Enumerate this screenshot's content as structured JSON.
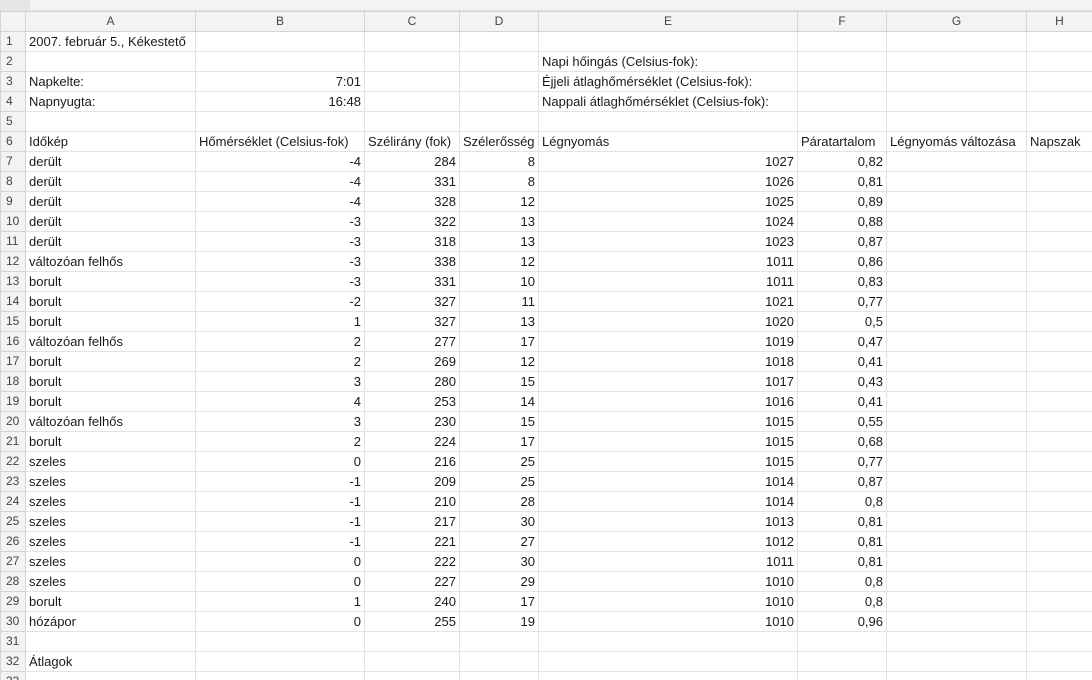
{
  "columns": [
    "A",
    "B",
    "C",
    "D",
    "E",
    "F",
    "G",
    "H"
  ],
  "cells": {
    "r1": {
      "a": "2007. február 5., Kékestető"
    },
    "r2": {
      "e": "Napi hőingás (Celsius-fok):"
    },
    "r3": {
      "a": "Napkelte:",
      "b": "7:01",
      "e": "Éjjeli átlaghőmérséklet (Celsius-fok):"
    },
    "r4": {
      "a": "Napnyugta:",
      "b": "16:48",
      "e": "Nappali átlaghőmérséklet (Celsius-fok):"
    },
    "r6": {
      "a": "Időkép",
      "b": "Hőmérséklet (Celsius-fok)",
      "c": "Szélirány (fok)",
      "d": "Szélerősség",
      "e": "Légnyomás",
      "f": "Páratartalom",
      "g": "Légnyomás változása",
      "h": "Napszak"
    },
    "r7": {
      "a": "derült",
      "b": "-4",
      "c": "284",
      "d": "8",
      "e": "1027",
      "f": "0,82"
    },
    "r8": {
      "a": "derült",
      "b": "-4",
      "c": "331",
      "d": "8",
      "e": "1026",
      "f": "0,81"
    },
    "r9": {
      "a": "derült",
      "b": "-4",
      "c": "328",
      "d": "12",
      "e": "1025",
      "f": "0,89"
    },
    "r10": {
      "a": "derült",
      "b": "-3",
      "c": "322",
      "d": "13",
      "e": "1024",
      "f": "0,88"
    },
    "r11": {
      "a": "derült",
      "b": "-3",
      "c": "318",
      "d": "13",
      "e": "1023",
      "f": "0,87"
    },
    "r12": {
      "a": "változóan felhős",
      "b": "-3",
      "c": "338",
      "d": "12",
      "e": "1011",
      "f": "0,86"
    },
    "r13": {
      "a": "borult",
      "b": "-3",
      "c": "331",
      "d": "10",
      "e": "1011",
      "f": "0,83"
    },
    "r14": {
      "a": "borult",
      "b": "-2",
      "c": "327",
      "d": "11",
      "e": "1021",
      "f": "0,77"
    },
    "r15": {
      "a": "borult",
      "b": "1",
      "c": "327",
      "d": "13",
      "e": "1020",
      "f": "0,5"
    },
    "r16": {
      "a": "változóan felhős",
      "b": "2",
      "c": "277",
      "d": "17",
      "e": "1019",
      "f": "0,47"
    },
    "r17": {
      "a": "borult",
      "b": "2",
      "c": "269",
      "d": "12",
      "e": "1018",
      "f": "0,41"
    },
    "r18": {
      "a": "borult",
      "b": "3",
      "c": "280",
      "d": "15",
      "e": "1017",
      "f": "0,43"
    },
    "r19": {
      "a": "borult",
      "b": "4",
      "c": "253",
      "d": "14",
      "e": "1016",
      "f": "0,41"
    },
    "r20": {
      "a": "változóan felhős",
      "b": "3",
      "c": "230",
      "d": "15",
      "e": "1015",
      "f": "0,55"
    },
    "r21": {
      "a": "borult",
      "b": "2",
      "c": "224",
      "d": "17",
      "e": "1015",
      "f": "0,68"
    },
    "r22": {
      "a": "szeles",
      "b": "0",
      "c": "216",
      "d": "25",
      "e": "1015",
      "f": "0,77"
    },
    "r23": {
      "a": "szeles",
      "b": "-1",
      "c": "209",
      "d": "25",
      "e": "1014",
      "f": "0,87"
    },
    "r24": {
      "a": "szeles",
      "b": "-1",
      "c": "210",
      "d": "28",
      "e": "1014",
      "f": "0,8"
    },
    "r25": {
      "a": "szeles",
      "b": "-1",
      "c": "217",
      "d": "30",
      "e": "1013",
      "f": "0,81"
    },
    "r26": {
      "a": "szeles",
      "b": "-1",
      "c": "221",
      "d": "27",
      "e": "1012",
      "f": "0,81"
    },
    "r27": {
      "a": "szeles",
      "b": "0",
      "c": "222",
      "d": "30",
      "e": "1011",
      "f": "0,81"
    },
    "r28": {
      "a": "szeles",
      "b": "0",
      "c": "227",
      "d": "29",
      "e": "1010",
      "f": "0,8"
    },
    "r29": {
      "a": "borult",
      "b": "1",
      "c": "240",
      "d": "17",
      "e": "1010",
      "f": "0,8"
    },
    "r30": {
      "a": "hózápor",
      "b": "0",
      "c": "255",
      "d": "19",
      "e": "1010",
      "f": "0,96"
    },
    "r32": {
      "a": "Átlagok"
    }
  },
  "row_numbers": [
    "1",
    "2",
    "3",
    "4",
    "5",
    "6",
    "7",
    "8",
    "9",
    "10",
    "11",
    "12",
    "13",
    "14",
    "15",
    "16",
    "17",
    "18",
    "19",
    "20",
    "21",
    "22",
    "23",
    "24",
    "25",
    "26",
    "27",
    "28",
    "29",
    "30",
    "31",
    "32",
    "33"
  ]
}
